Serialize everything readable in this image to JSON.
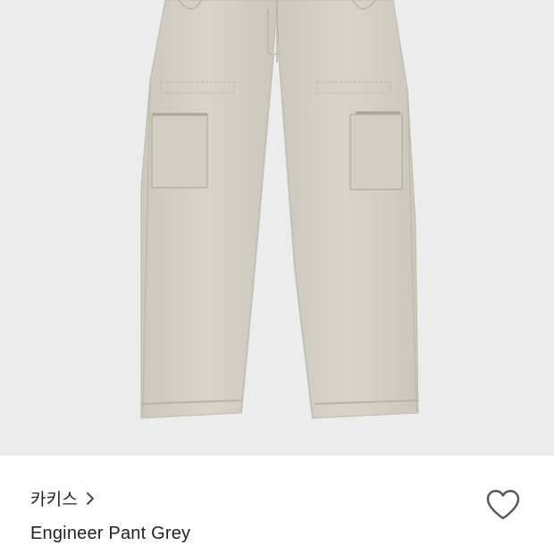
{
  "product": {
    "brand": "카키스",
    "name": "Engineer Pant Grey"
  },
  "icons": {
    "brand_link": "chevron-right-icon",
    "like": "heart-outline-icon"
  },
  "colors": {
    "image_background": "#ececec",
    "pant_fabric": "#d6d2c8",
    "text_primary": "#222222",
    "icon_stroke": "#555555"
  }
}
